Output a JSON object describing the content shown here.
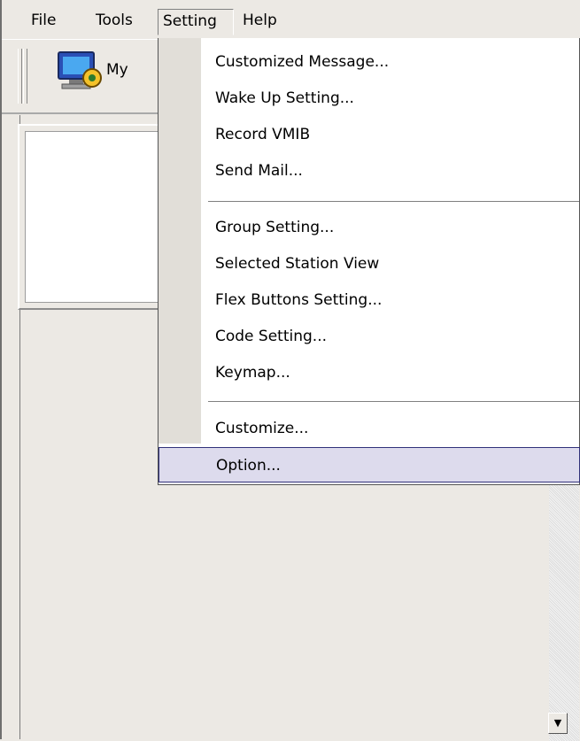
{
  "menubar": {
    "file": "File",
    "tools": "Tools",
    "setting": "Setting",
    "help": "Help"
  },
  "toolbar": {
    "button_label": "My"
  },
  "setting_menu": {
    "items": [
      "Customized Message...",
      "Wake Up Setting...",
      "Record VMIB",
      "Send Mail...",
      "Group Setting...",
      "Selected Station View",
      "Flex Buttons Setting...",
      "Code Setting...",
      "Keymap...",
      "Customize...",
      "Option..."
    ],
    "highlighted": "Option..."
  },
  "colors": {
    "background": "#ece9e4",
    "menu_highlight": "#dddbed",
    "highlight_border": "#31317a"
  }
}
